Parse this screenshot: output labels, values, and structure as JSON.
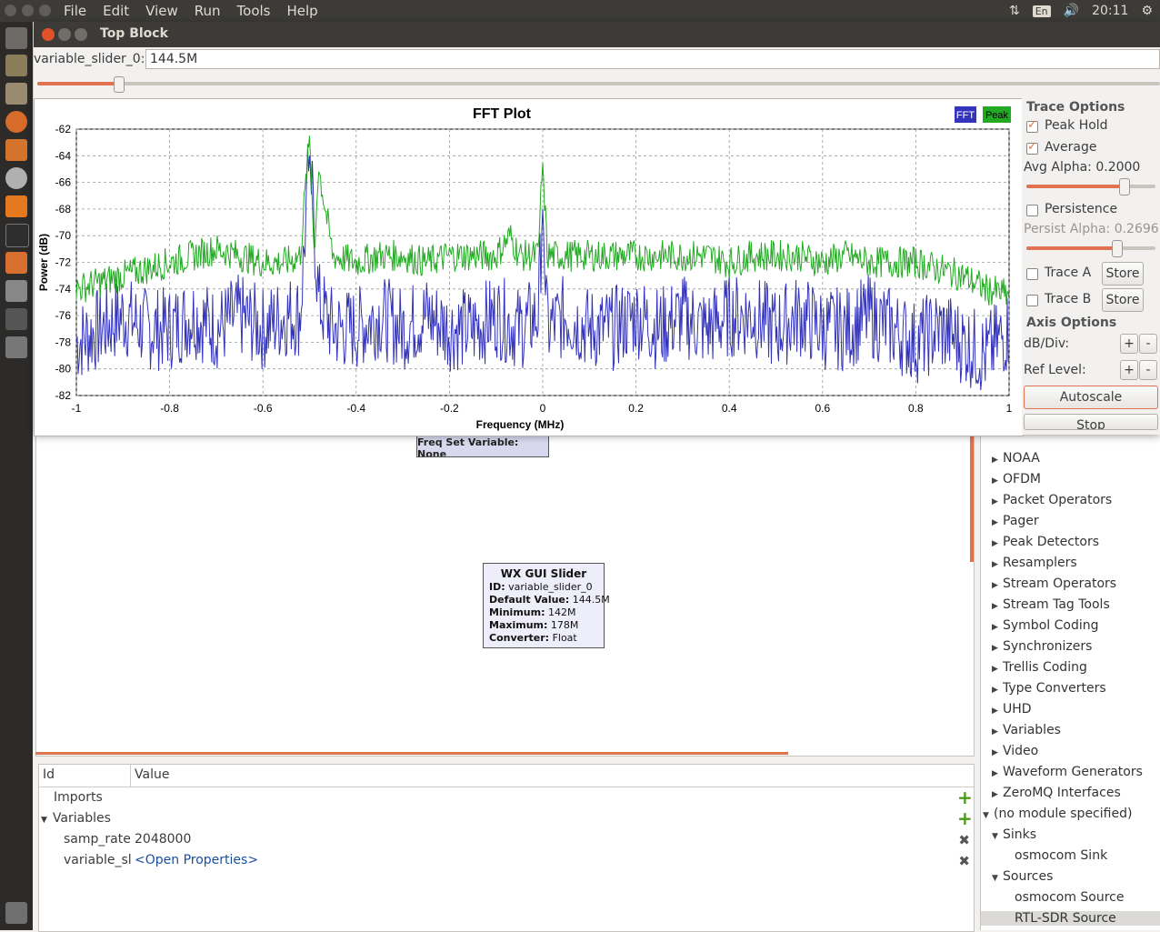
{
  "menubar": {
    "menus": [
      "File",
      "Edit",
      "View",
      "Run",
      "Tools",
      "Help"
    ],
    "language": "En",
    "clock": "20:11"
  },
  "window": {
    "title": "Top Block"
  },
  "slider": {
    "label": "variable_slider_0:",
    "value": "144.5M",
    "position_fraction": 0.072
  },
  "chart_data": {
    "type": "line",
    "title": "FFT Plot",
    "xlabel": "Frequency (MHz)",
    "ylabel": "Power (dB)",
    "xlim": [
      -1,
      1
    ],
    "ylim": [
      -82,
      -62
    ],
    "xticks": [
      "-1",
      "-0.8",
      "-0.6",
      "-0.4",
      "-0.2",
      "0",
      "0.2",
      "0.4",
      "0.6",
      "0.8",
      "1"
    ],
    "yticks": [
      "-62",
      "-64",
      "-66",
      "-68",
      "-70",
      "-72",
      "-74",
      "-76",
      "-78",
      "-80",
      "-82"
    ],
    "grid": true,
    "legend": [
      "FFT",
      "Peak"
    ],
    "legend_position": "top-right",
    "colors": {
      "fft": "#3333bb",
      "peak": "#22aa22"
    },
    "series": [
      {
        "name": "FFT",
        "x": [
          -1.0,
          -0.95,
          -0.9,
          -0.85,
          -0.8,
          -0.75,
          -0.7,
          -0.65,
          -0.6,
          -0.55,
          -0.52,
          -0.5,
          -0.48,
          -0.45,
          -0.4,
          -0.35,
          -0.3,
          -0.25,
          -0.2,
          -0.15,
          -0.1,
          -0.05,
          -0.01,
          0.0,
          0.01,
          0.05,
          0.1,
          0.15,
          0.2,
          0.25,
          0.3,
          0.35,
          0.4,
          0.45,
          0.5,
          0.55,
          0.6,
          0.65,
          0.7,
          0.75,
          0.8,
          0.85,
          0.9,
          0.95,
          1.0
        ],
        "values": [
          -78,
          -77,
          -76,
          -77,
          -77,
          -76,
          -77,
          -76,
          -77,
          -76,
          -76,
          -64,
          -75,
          -77,
          -77,
          -76,
          -77,
          -76,
          -77,
          -77,
          -76,
          -77,
          -76,
          -68,
          -77,
          -76,
          -77,
          -77,
          -76,
          -77,
          -76,
          -77,
          -76,
          -76,
          -77,
          -76,
          -77,
          -77,
          -76,
          -77,
          -78,
          -77,
          -78,
          -79,
          -77
        ]
      },
      {
        "name": "Peak",
        "x": [
          -1.0,
          -0.95,
          -0.9,
          -0.85,
          -0.8,
          -0.75,
          -0.7,
          -0.65,
          -0.6,
          -0.55,
          -0.52,
          -0.5,
          -0.49,
          -0.48,
          -0.45,
          -0.4,
          -0.35,
          -0.3,
          -0.25,
          -0.2,
          -0.15,
          -0.1,
          -0.07,
          -0.05,
          -0.01,
          0.0,
          0.01,
          0.05,
          0.1,
          0.15,
          0.2,
          0.25,
          0.3,
          0.35,
          0.4,
          0.45,
          0.5,
          0.55,
          0.6,
          0.65,
          0.7,
          0.75,
          0.8,
          0.85,
          0.9,
          0.95,
          1.0
        ],
        "values": [
          -74,
          -73.5,
          -73,
          -72.5,
          -72,
          -71.5,
          -71,
          -71.5,
          -72,
          -72,
          -71.5,
          -62.5,
          -71,
          -65,
          -71.5,
          -72,
          -71.5,
          -71.5,
          -72,
          -71.5,
          -71.5,
          -71.5,
          -70,
          -71.5,
          -71.5,
          -64.5,
          -71.5,
          -71.5,
          -71.5,
          -71.5,
          -71.5,
          -71.5,
          -71.5,
          -71.5,
          -72,
          -71.5,
          -71.5,
          -71.5,
          -72,
          -71.5,
          -72,
          -72,
          -72,
          -72.5,
          -73,
          -74,
          -74.5
        ]
      }
    ]
  },
  "trace_options": {
    "heading": "Trace Options",
    "peak_hold": {
      "label": "Peak Hold",
      "checked": true
    },
    "average": {
      "label": "Average",
      "checked": true
    },
    "avg_alpha_label": "Avg Alpha: 0.2000",
    "avg_alpha_fraction": 0.75,
    "persistence": {
      "label": "Persistence",
      "checked": false
    },
    "persist_alpha_label": "Persist Alpha: 0.2696",
    "persist_alpha_fraction": 0.7,
    "trace_a": {
      "label": "Trace A",
      "button": "Store"
    },
    "trace_b": {
      "label": "Trace B",
      "button": "Store"
    }
  },
  "axis_options": {
    "heading": "Axis Options",
    "db_div_label": "dB/Div:",
    "ref_level_label": "Ref Level:",
    "plus": "+",
    "minus": "-",
    "autoscale": "Autoscale",
    "stop": "Stop"
  },
  "flowgraph": {
    "partial_block_text": "Freq Set Variable: None",
    "block": {
      "title": "WX GUI Slider",
      "rows": [
        {
          "key": "ID:",
          "value": "variable_slider_0"
        },
        {
          "key": "Default Value:",
          "value": "144.5M"
        },
        {
          "key": "Minimum:",
          "value": "142M"
        },
        {
          "key": "Maximum:",
          "value": "178M"
        },
        {
          "key": "Converter:",
          "value": "Float"
        }
      ]
    }
  },
  "variables_panel": {
    "col_id": "Id",
    "col_value": "Value",
    "imports": "Imports",
    "variables": "Variables",
    "rows": [
      {
        "id": "samp_rate",
        "value": "2048000"
      },
      {
        "id": "variable_sl",
        "value": "<Open Properties>"
      }
    ]
  },
  "block_tree": {
    "categories": [
      "NOAA",
      "OFDM",
      "Packet Operators",
      "Pager",
      "Peak Detectors",
      "Resamplers",
      "Stream Operators",
      "Stream Tag Tools",
      "Symbol Coding",
      "Synchronizers",
      "Trellis Coding",
      "Type Converters",
      "UHD",
      "Variables",
      "Video",
      "Waveform Generators",
      "ZeroMQ Interfaces"
    ],
    "no_module": "(no module specified)",
    "sinks": "Sinks",
    "sink_item": "osmocom Sink",
    "sources": "Sources",
    "source_items": [
      "osmocom Source",
      "RTL-SDR Source"
    ]
  }
}
